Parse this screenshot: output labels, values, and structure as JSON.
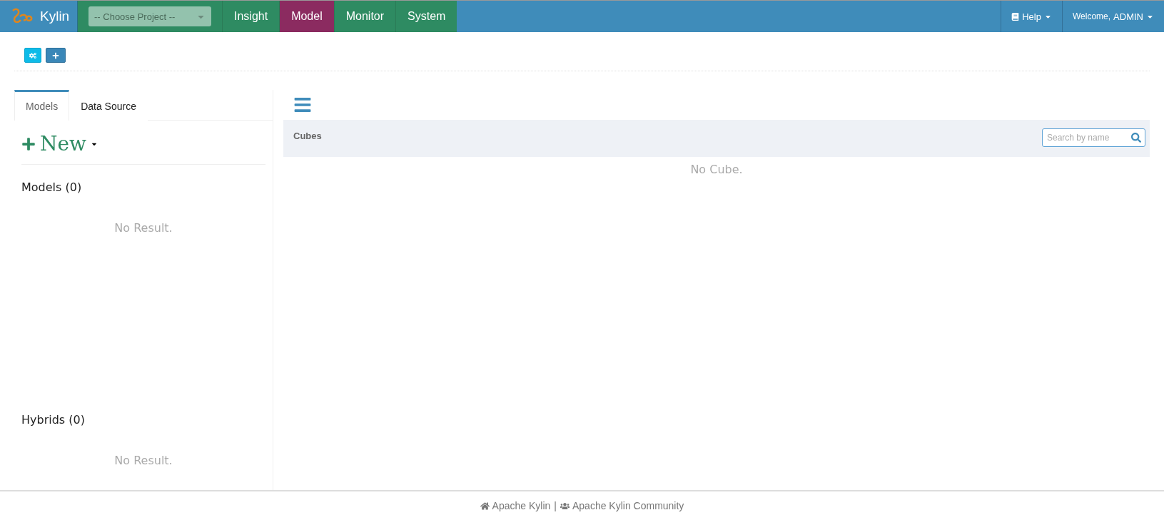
{
  "navbar": {
    "brand": "Kylin",
    "project_select": {
      "placeholder": "-- Choose Project --"
    },
    "tabs": [
      {
        "label": "Insight",
        "selected": false
      },
      {
        "label": "Model",
        "selected": true
      },
      {
        "label": "Monitor",
        "selected": false
      },
      {
        "label": "System",
        "selected": false
      }
    ],
    "help": "Help",
    "welcome": "Welcome,",
    "user": "ADMIN"
  },
  "left_panel": {
    "tabs": [
      {
        "label": "Models",
        "selected": true
      },
      {
        "label": "Data Source",
        "selected": false
      }
    ],
    "new_button": "New",
    "sections": [
      {
        "title": "Models (0)",
        "empty": "No Result."
      },
      {
        "title": "Hybrids (0)",
        "empty": "No Result."
      }
    ]
  },
  "cubes": {
    "title": "Cubes",
    "search": {
      "placeholder": "Search by name"
    },
    "empty": "No Cube."
  },
  "footer": {
    "links": [
      "Apache Kylin",
      "Apache Kylin Community"
    ],
    "separator": "|"
  }
}
